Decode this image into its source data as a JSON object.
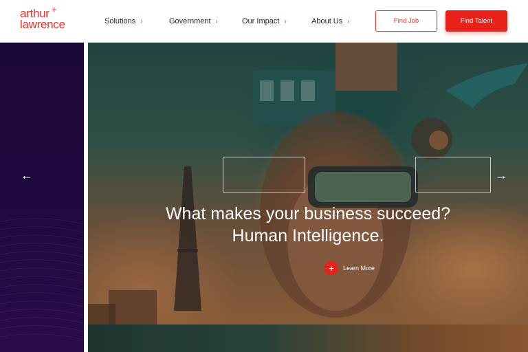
{
  "brand": {
    "line1": "arthur",
    "line2": "lawrence",
    "mark": "+"
  },
  "nav": [
    {
      "label": "Solutions",
      "chevron": "›"
    },
    {
      "label": "Government",
      "chevron": "›"
    },
    {
      "label": "Our Impact",
      "chevron": "›"
    },
    {
      "label": "About Us",
      "chevron": "›"
    }
  ],
  "buttons": {
    "find_job": "Find Job",
    "find_talent": "Find Talent"
  },
  "hero": {
    "title_line1": "What makes your business succeed?",
    "title_line2": "Human Intelligence.",
    "cta_label": "Learn More",
    "cta_icon": "+",
    "prev_icon": "←",
    "next_icon": "→"
  },
  "colors": {
    "accent": "#e8221b",
    "panel": "#22093f"
  }
}
